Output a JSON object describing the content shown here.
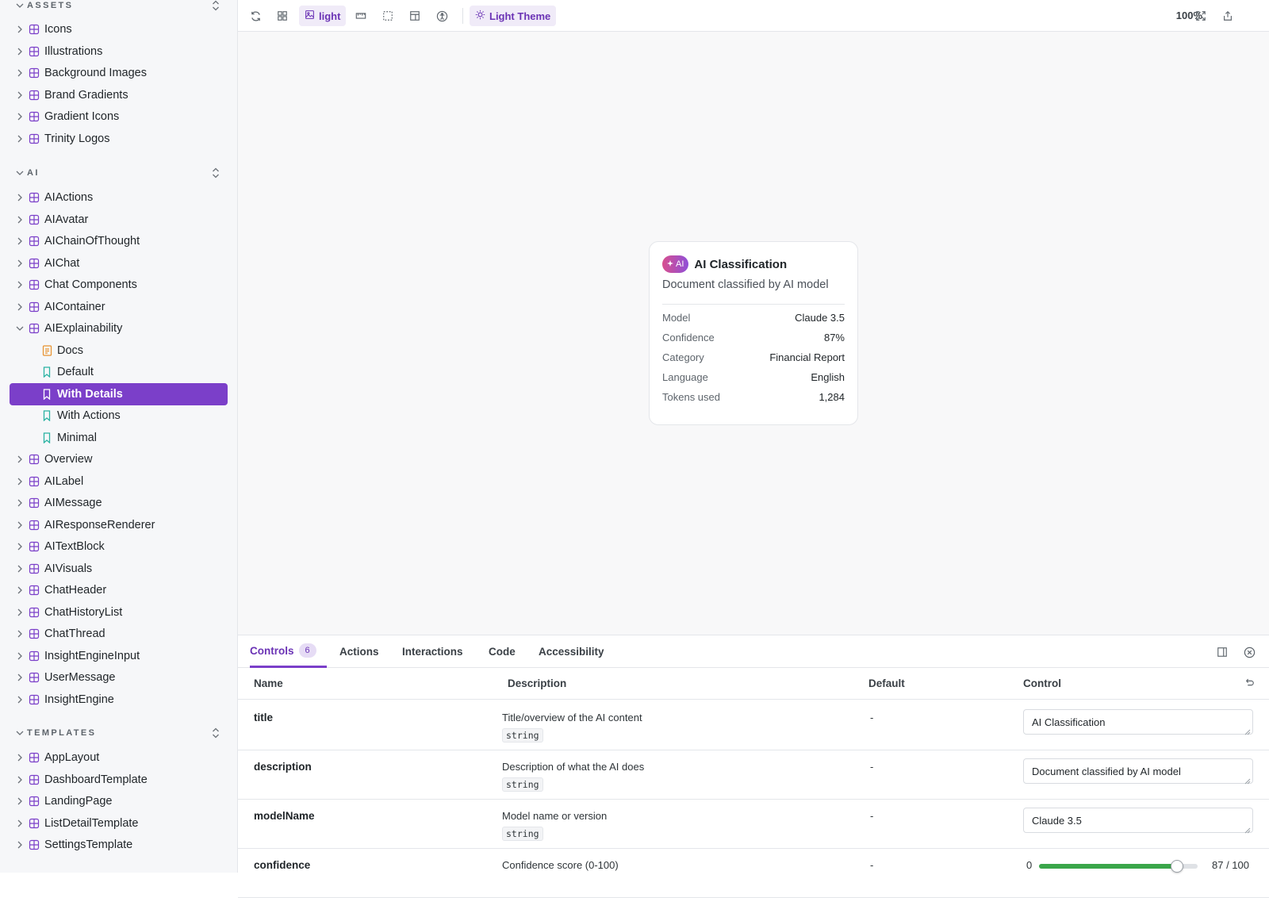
{
  "sidebar": {
    "sections": [
      {
        "title": "ASSETS",
        "items": [
          {
            "label": "Icons"
          },
          {
            "label": "Illustrations"
          },
          {
            "label": "Background Images"
          },
          {
            "label": "Brand Gradients"
          },
          {
            "label": "Gradient Icons"
          },
          {
            "label": "Trinity Logos"
          }
        ]
      },
      {
        "title": "AI",
        "items": [
          {
            "label": "AIActions"
          },
          {
            "label": "AIAvatar"
          },
          {
            "label": "AIChainOfThought"
          },
          {
            "label": "AIChat"
          },
          {
            "label": "Chat Components"
          },
          {
            "label": "AIContainer"
          },
          {
            "label": "AIExplainability",
            "expanded": true,
            "children": [
              {
                "label": "Docs",
                "kind": "docs"
              },
              {
                "label": "Default",
                "kind": "story"
              },
              {
                "label": "With Details",
                "kind": "story",
                "selected": true
              },
              {
                "label": "With Actions",
                "kind": "story"
              },
              {
                "label": "Minimal",
                "kind": "story"
              }
            ]
          },
          {
            "label": "Overview"
          },
          {
            "label": "AILabel"
          },
          {
            "label": "AIMessage"
          },
          {
            "label": "AIResponseRenderer"
          },
          {
            "label": "AITextBlock"
          },
          {
            "label": "AIVisuals"
          },
          {
            "label": "ChatHeader"
          },
          {
            "label": "ChatHistoryList"
          },
          {
            "label": "ChatThread"
          },
          {
            "label": "InsightEngineInput"
          },
          {
            "label": "UserMessage"
          },
          {
            "label": "InsightEngine"
          }
        ]
      },
      {
        "title": "TEMPLATES",
        "items": [
          {
            "label": "AppLayout"
          },
          {
            "label": "DashboardTemplate"
          },
          {
            "label": "LandingPage"
          },
          {
            "label": "ListDetailTemplate"
          },
          {
            "label": "SettingsTemplate"
          }
        ]
      }
    ]
  },
  "toolbar": {
    "background_label": "light",
    "theme_label": "Light Theme",
    "zoom": "100%"
  },
  "card": {
    "badge": "AI",
    "title": "AI Classification",
    "description": "Document classified by AI model",
    "rows": [
      {
        "key": "Model",
        "value": "Claude 3.5"
      },
      {
        "key": "Confidence",
        "value": "87%"
      },
      {
        "key": "Category",
        "value": "Financial Report"
      },
      {
        "key": "Language",
        "value": "English"
      },
      {
        "key": "Tokens used",
        "value": "1,284"
      }
    ]
  },
  "panel": {
    "tabs": [
      {
        "label": "Controls",
        "count": "6",
        "active": true
      },
      {
        "label": "Actions"
      },
      {
        "label": "Interactions"
      },
      {
        "label": "Code"
      },
      {
        "label": "Accessibility"
      }
    ],
    "columns": {
      "name": "Name",
      "description": "Description",
      "default": "Default",
      "control": "Control"
    },
    "rows": [
      {
        "name": "title",
        "description": "Title/overview of the AI content",
        "type": "string",
        "default": "-",
        "control": "AI Classification"
      },
      {
        "name": "description",
        "description": "Description of what the AI does",
        "type": "string",
        "default": "-",
        "control": "Document classified by AI model"
      },
      {
        "name": "modelName",
        "description": "Model name or version",
        "type": "string",
        "default": "-",
        "control": "Claude 3.5"
      },
      {
        "name": "confidence",
        "description": "Confidence score (0-100)",
        "type": "",
        "default": "-",
        "slider_min": "0",
        "slider_value": 87,
        "slider_max": 100,
        "slider_text": "87 / 100"
      }
    ]
  },
  "colors": {
    "accent": "#7b3fc9",
    "slider": "#3aa64a",
    "ai_badge_start": "#d84f8e",
    "ai_badge_end": "#8f4fd8"
  }
}
